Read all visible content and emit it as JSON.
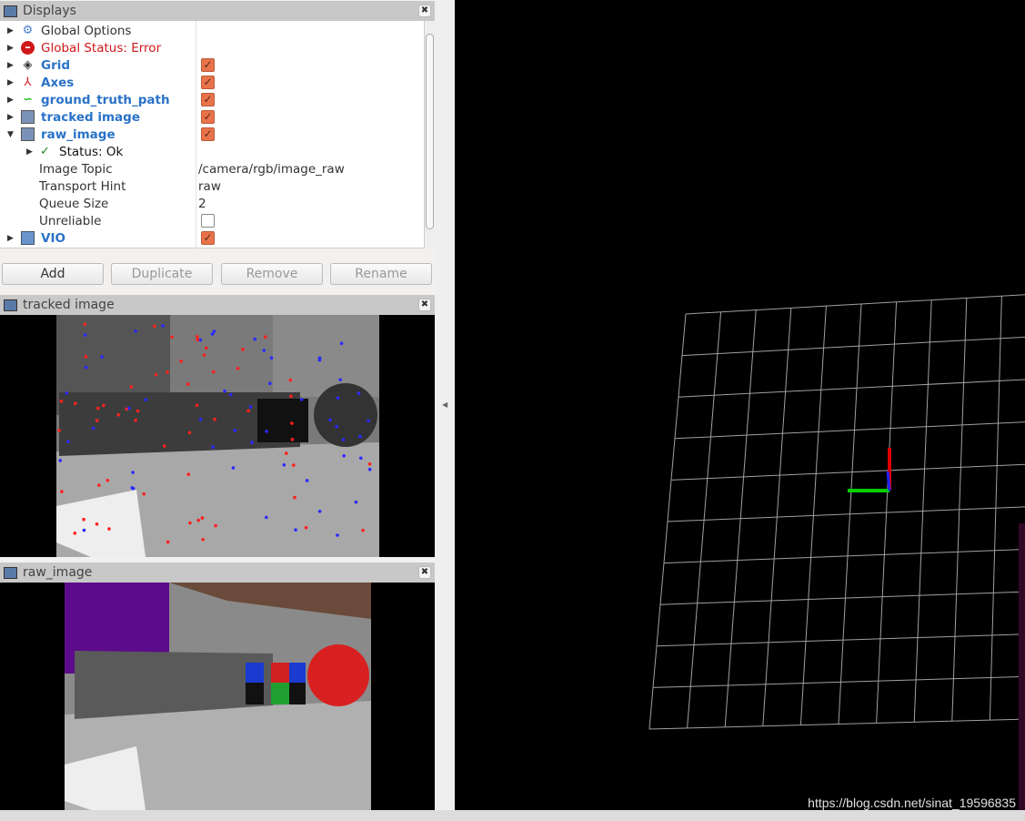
{
  "displays": {
    "title": "Displays",
    "items": [
      {
        "label": "Global Options",
        "icon": "gear-icon",
        "expanded": false
      },
      {
        "label": "Global Status: Error",
        "icon": "error-icon",
        "expanded": false
      },
      {
        "label": "Grid",
        "icon": "grid-icon",
        "checked": true
      },
      {
        "label": "Axes",
        "icon": "axes-icon",
        "checked": true
      },
      {
        "label": "ground_truth_path",
        "icon": "path-icon",
        "checked": true
      },
      {
        "label": "tracked image",
        "icon": "image-icon",
        "checked": true
      },
      {
        "label": "raw_image",
        "icon": "image-icon",
        "checked": true,
        "expanded": true
      }
    ],
    "raw_image_children": {
      "status": "Status: Ok",
      "props": [
        {
          "name": "Image Topic",
          "value": "/camera/rgb/image_raw"
        },
        {
          "name": "Transport Hint",
          "value": "raw"
        },
        {
          "name": "Queue Size",
          "value": "2"
        },
        {
          "name": "Unreliable",
          "checked": false
        }
      ]
    },
    "vio": {
      "label": "VIO",
      "icon": "folder-icon",
      "checked": true
    },
    "buttons": {
      "add": "Add",
      "duplicate": "Duplicate",
      "remove": "Remove",
      "rename": "Rename"
    }
  },
  "tracked_panel": {
    "title": "tracked image"
  },
  "raw_panel": {
    "title": "raw_image"
  },
  "view": {
    "watermark": "https://blog.csdn.net/sinat_19596835",
    "background": "#000000",
    "grid_color": "#a0a0a0"
  }
}
